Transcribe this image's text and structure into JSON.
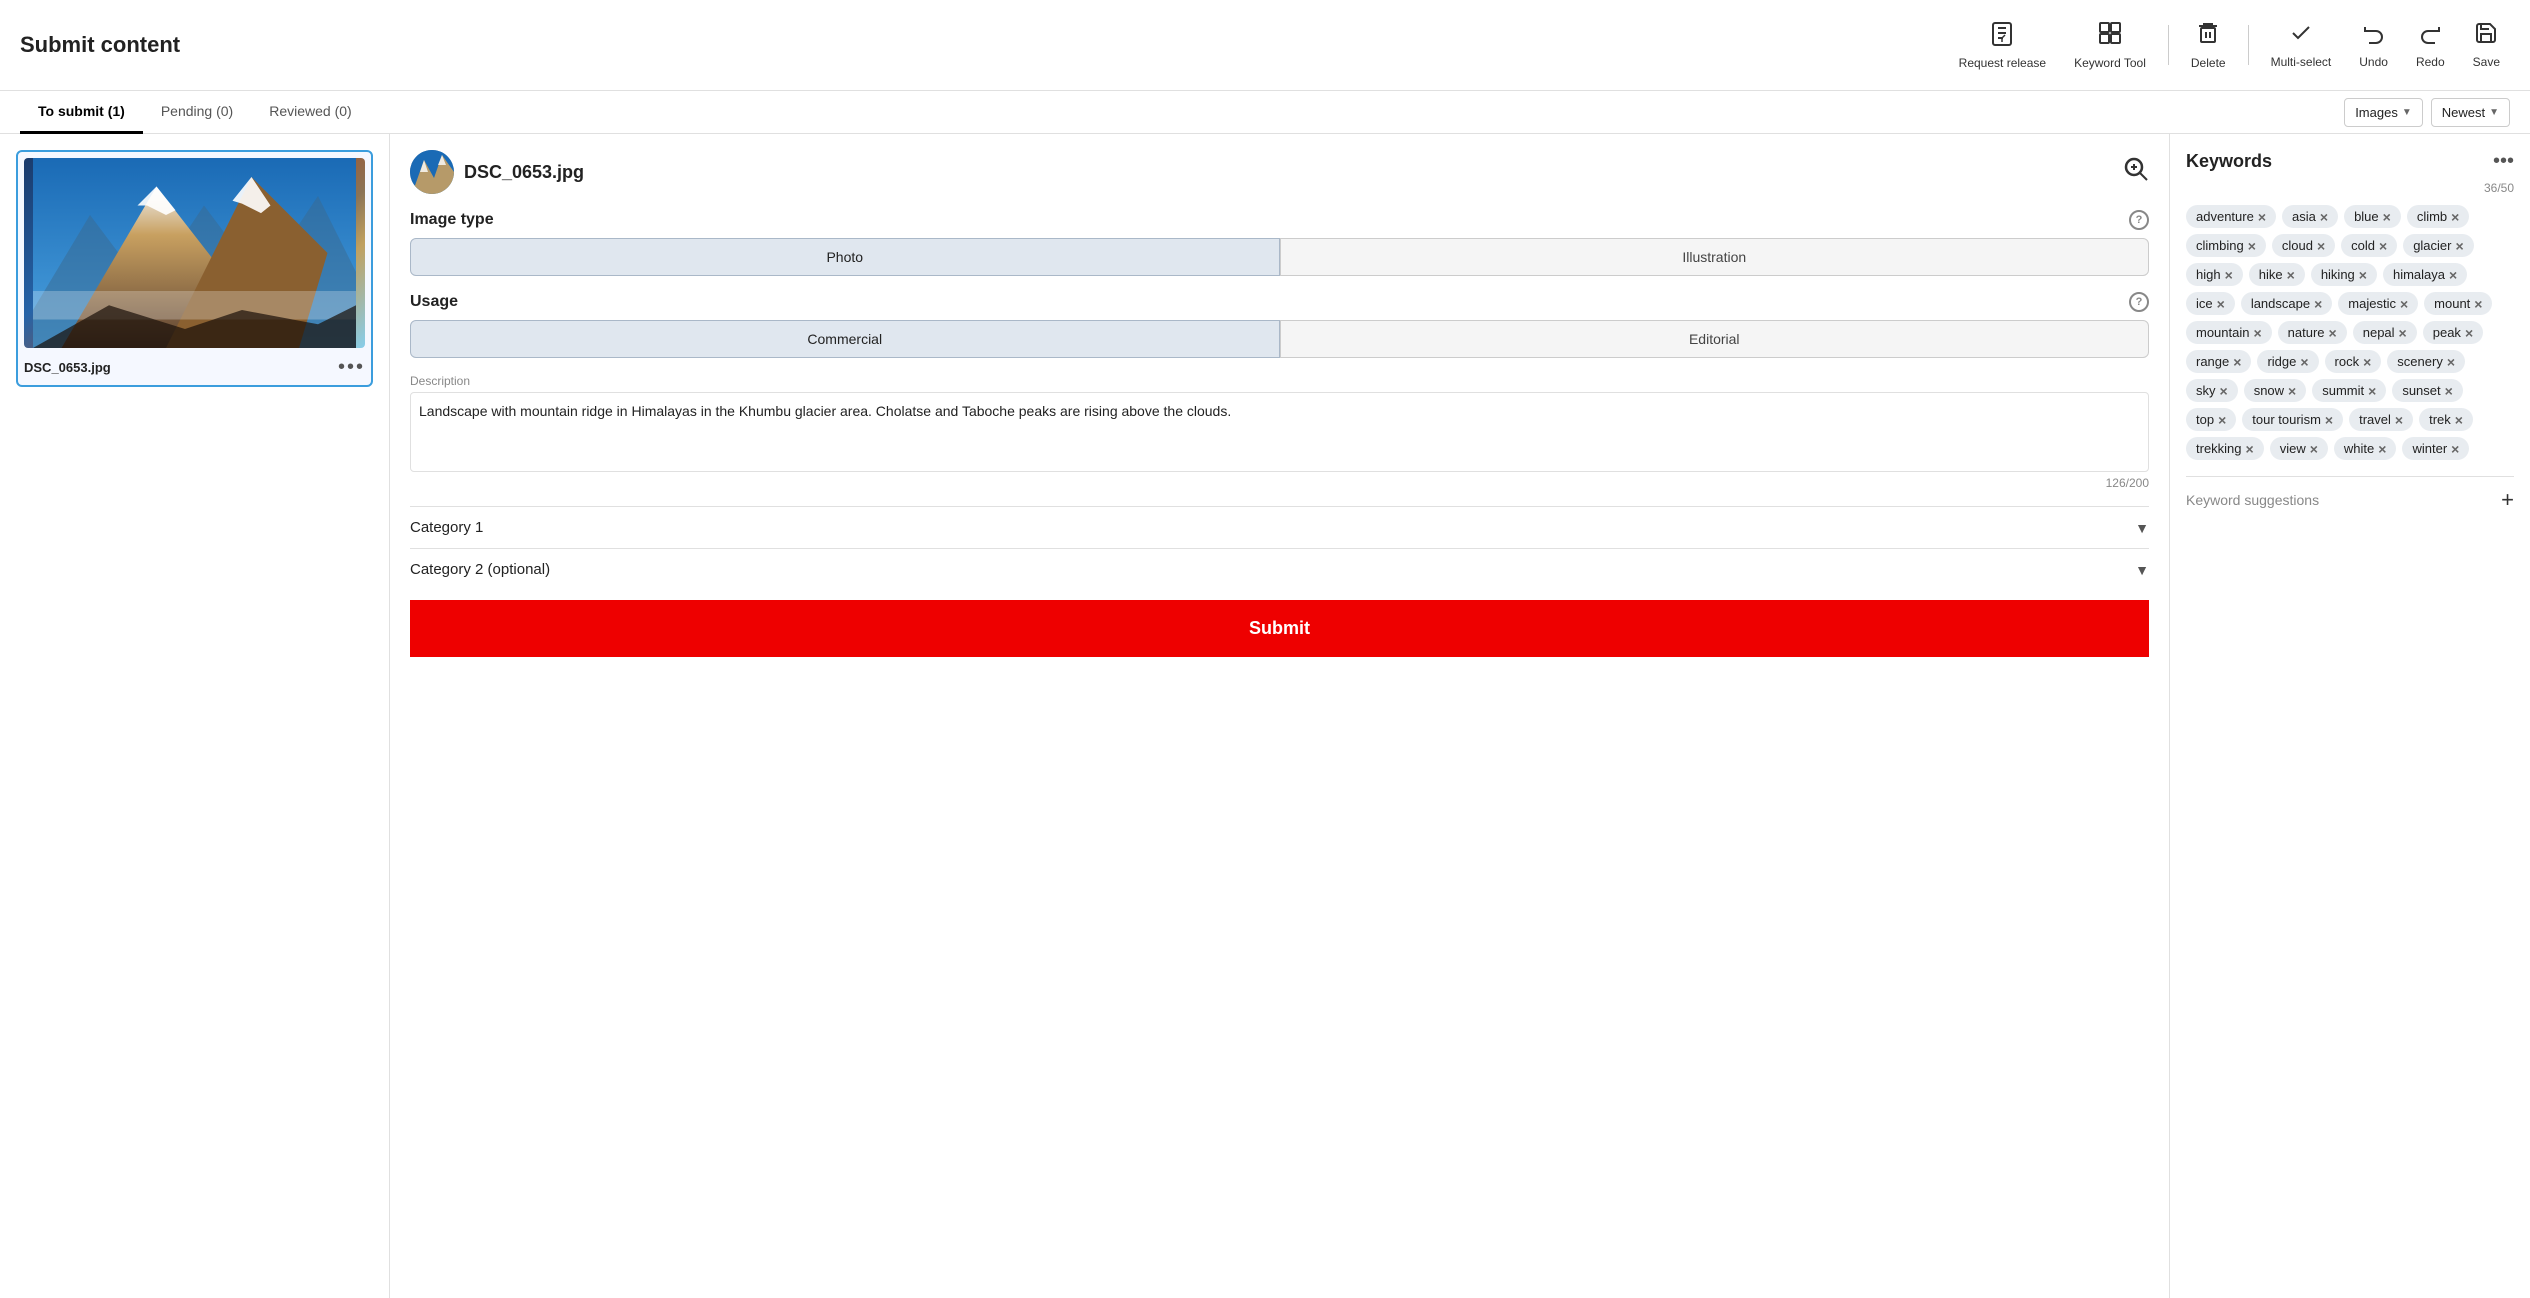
{
  "header": {
    "title": "Submit content",
    "toolbar": {
      "request_release_label": "Request release",
      "keyword_tool_label": "Keyword Tool",
      "delete_label": "Delete",
      "multiselect_label": "Multi-select",
      "undo_label": "Undo",
      "redo_label": "Redo",
      "save_label": "Save"
    }
  },
  "tabs": {
    "to_submit": "To submit (1)",
    "pending": "Pending (0)",
    "reviewed": "Reviewed (0)"
  },
  "filters": {
    "type_label": "Images",
    "sort_label": "Newest"
  },
  "image_card": {
    "filename": "DSC_0653.jpg",
    "menu_icon": "•••"
  },
  "detail": {
    "filename": "DSC_0653.jpg",
    "image_type_label": "Image type",
    "photo_label": "Photo",
    "illustration_label": "Illustration",
    "usage_label": "Usage",
    "commercial_label": "Commercial",
    "editorial_label": "Editorial",
    "description_label": "Description",
    "description_text": "Landscape with mountain ridge in Himalayas in the Khumbu glacier area. Cholatse and Taboche peaks are rising above the clouds.",
    "description_count": "126/200",
    "category1_label": "Category 1",
    "category2_label": "Category 2 (optional)",
    "submit_label": "Submit"
  },
  "keywords": {
    "title": "Keywords",
    "count": "36/50",
    "tags": [
      "adventure",
      "asia",
      "blue",
      "climb",
      "climbing",
      "cloud",
      "cold",
      "glacier",
      "high",
      "hike",
      "hiking",
      "himalaya",
      "ice",
      "landscape",
      "majestic",
      "mount",
      "mountain",
      "nature",
      "nepal",
      "peak",
      "range",
      "ridge",
      "rock",
      "scenery",
      "sky",
      "snow",
      "summit",
      "sunset",
      "top",
      "tour tourism",
      "travel",
      "trek",
      "trekking",
      "view",
      "white",
      "winter"
    ],
    "suggestions_label": "Keyword suggestions"
  }
}
